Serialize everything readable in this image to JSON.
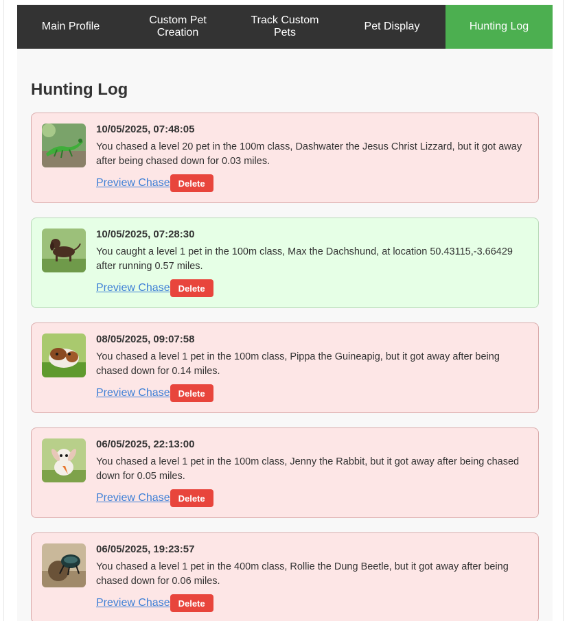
{
  "nav": {
    "items": [
      {
        "label": "Main Profile",
        "active": false
      },
      {
        "label": "Custom Pet Creation",
        "active": false
      },
      {
        "label": "Track Custom Pets",
        "active": false
      },
      {
        "label": "Pet Display",
        "active": false
      },
      {
        "label": "Hunting Log",
        "active": true
      }
    ]
  },
  "page": {
    "title": "Hunting Log"
  },
  "colors": {
    "nav_bg": "#333333",
    "nav_active": "#4caf50",
    "failed_bg": "#fde6e6",
    "caught_bg": "#e6ffe6",
    "delete_button": "#e8453c",
    "link": "#3d7fd6"
  },
  "log": {
    "entries": [
      {
        "timestamp": "10/05/2025, 07:48:05",
        "message": "You chased a level 20 pet in the 100m class, Dashwater the Jesus Christ Lizzard, but it got away after being chased down for 0.03 miles.",
        "status": "escaped",
        "image": "lizard-image",
        "preview_label": "Preview Chase",
        "delete_label": "Delete"
      },
      {
        "timestamp": "10/05/2025, 07:28:30",
        "message": "You caught a level 1 pet in the 100m class, Max the Dachshund, at location 50.43115,-3.66429 after running 0.57 miles.",
        "status": "caught",
        "image": "dachshund-image",
        "preview_label": "Preview Chase",
        "delete_label": "Delete"
      },
      {
        "timestamp": "08/05/2025, 09:07:58",
        "message": "You chased a level 1 pet in the 100m class, Pippa the Guineapig, but it got away after being chased down for 0.14 miles.",
        "status": "escaped",
        "image": "guineapig-image",
        "preview_label": "Preview Chase",
        "delete_label": "Delete"
      },
      {
        "timestamp": "06/05/2025, 22:13:00",
        "message": "You chased a level 1 pet in the 100m class, Jenny the Rabbit, but it got away after being chased down for 0.05 miles.",
        "status": "escaped",
        "image": "rabbit-image",
        "preview_label": "Preview Chase",
        "delete_label": "Delete"
      },
      {
        "timestamp": "06/05/2025, 19:23:57",
        "message": "You chased a level 1 pet in the 400m class, Rollie the Dung Beetle, but it got away after being chased down for 0.06 miles.",
        "status": "escaped",
        "image": "beetle-image",
        "preview_label": "Preview Chase",
        "delete_label": "Delete"
      }
    ]
  }
}
